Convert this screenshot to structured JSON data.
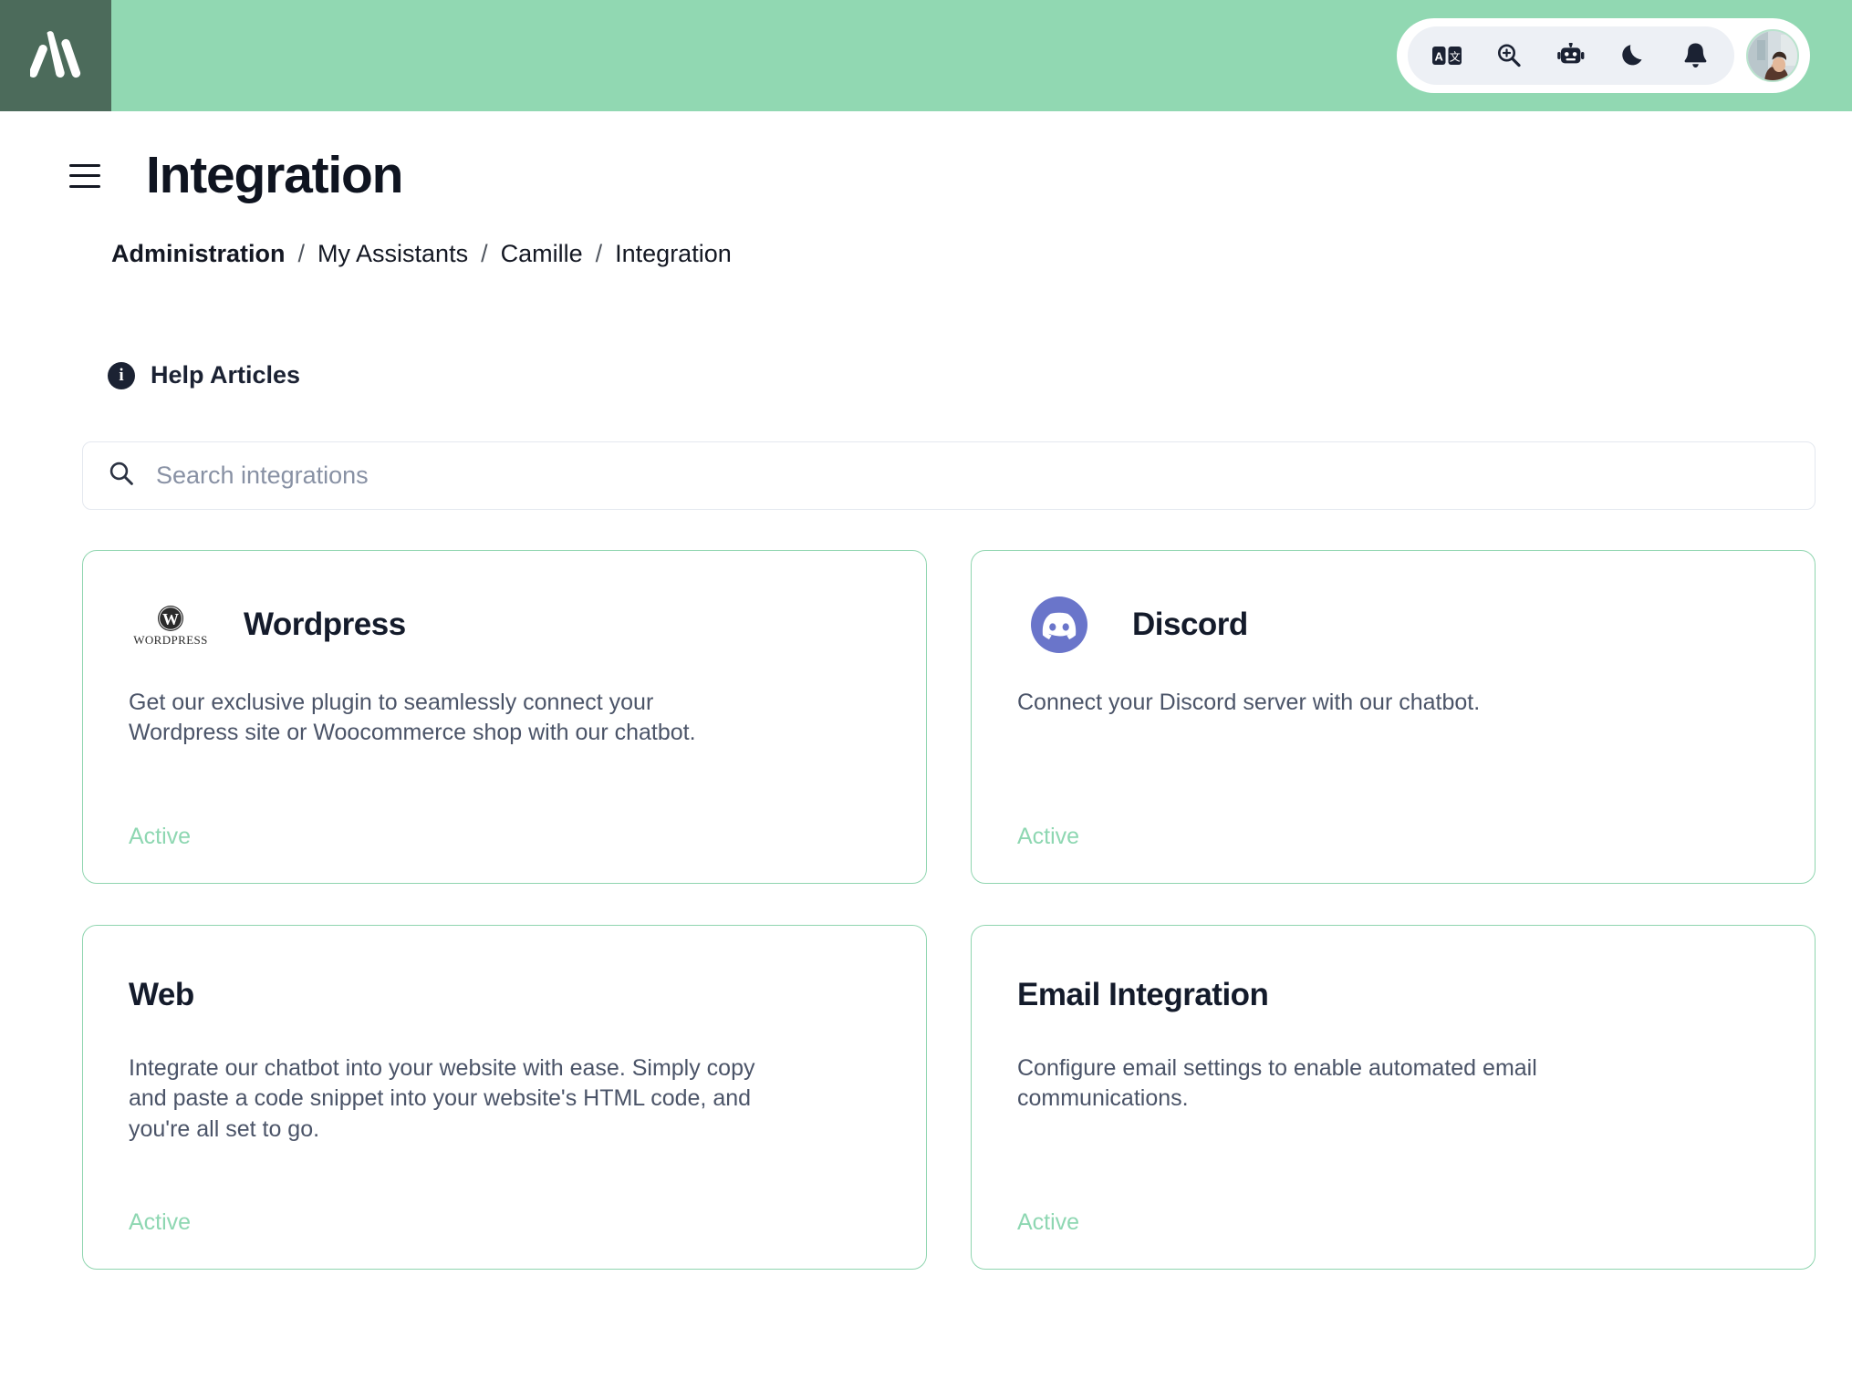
{
  "brand": {
    "logo_name": "logo-mark",
    "logo_square_color": "#4c6b5b",
    "header_color": "#91d8b2",
    "accent_green": "#8fd5af"
  },
  "topbar": {
    "tools": [
      {
        "name": "translate-icon",
        "label": "Translate"
      },
      {
        "name": "zoom-in-icon",
        "label": "Zoom in"
      },
      {
        "name": "robot-icon",
        "label": "Assistant"
      },
      {
        "name": "moon-icon",
        "label": "Dark mode"
      },
      {
        "name": "bell-icon",
        "label": "Notifications"
      }
    ],
    "avatar_alt": "User avatar"
  },
  "header": {
    "menu_label": "Menu",
    "title": "Integration"
  },
  "breadcrumb": {
    "separator": "/",
    "items": [
      {
        "label": "Administration",
        "bold": true
      },
      {
        "label": "My Assistants",
        "bold": false
      },
      {
        "label": "Camille",
        "bold": false
      },
      {
        "label": "Integration",
        "bold": false
      }
    ]
  },
  "help": {
    "icon": "info-icon",
    "label": "Help Articles"
  },
  "search": {
    "icon": "search-icon",
    "placeholder": "Search integrations",
    "value": ""
  },
  "cards": [
    {
      "id": "wordpress",
      "title": "Wordpress",
      "logo": "wordpress-logo",
      "logo_text": "WordPress",
      "description": "Get our exclusive plugin to seamlessly connect your Wordpress site or Woocommerce shop with our chatbot.",
      "status": "Active"
    },
    {
      "id": "discord",
      "title": "Discord",
      "logo": "discord-logo",
      "logo_color": "#6a75ca",
      "description": "Connect your Discord server with our chatbot.",
      "status": "Active"
    },
    {
      "id": "web",
      "title": "Web",
      "logo": "",
      "description": "Integrate our chatbot into your website with ease. Simply copy and paste a code snippet into your website's HTML code, and you're all set to go.",
      "status": "Active"
    },
    {
      "id": "email",
      "title": "Email Integration",
      "logo": "",
      "description": "Configure email settings to enable automated email communications.",
      "status": "Active"
    }
  ]
}
